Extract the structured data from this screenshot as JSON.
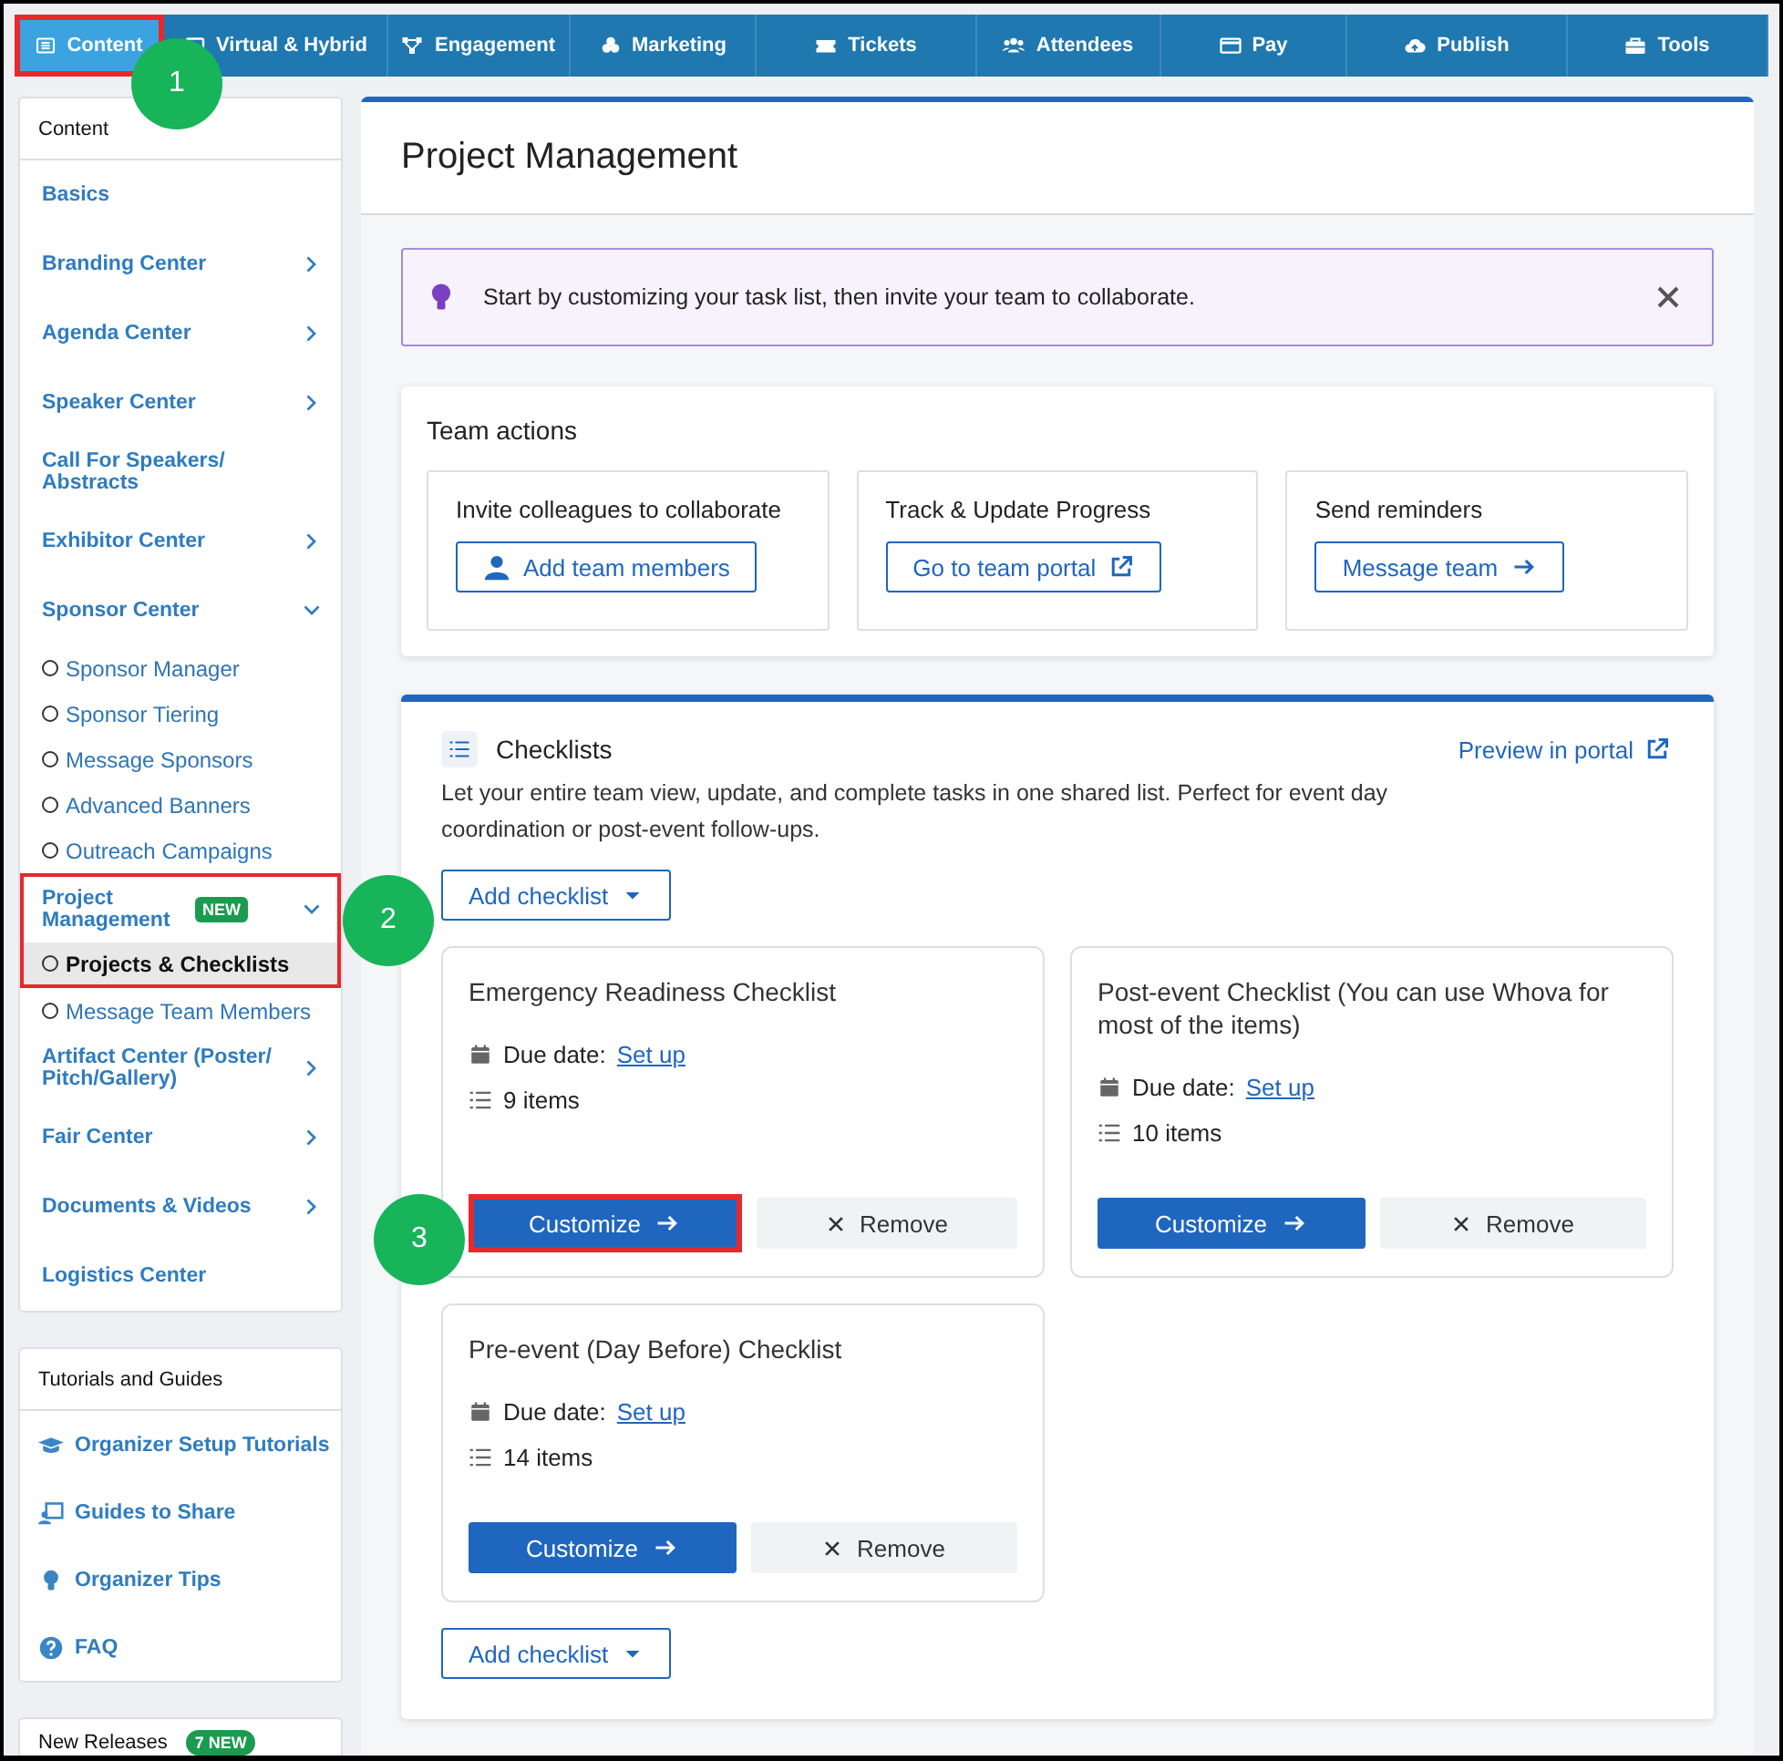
{
  "top_nav": [
    {
      "label": "Content",
      "selected": true,
      "highlighted": true
    },
    {
      "label": "Virtual & Hybrid",
      "selected": false,
      "highlighted": false
    },
    {
      "label": "Engagement",
      "selected": false,
      "highlighted": false
    },
    {
      "label": "Marketing",
      "selected": false,
      "highlighted": false
    },
    {
      "label": "Tickets",
      "selected": false,
      "highlighted": false
    },
    {
      "label": "Attendees",
      "selected": false,
      "highlighted": false
    },
    {
      "label": "Pay",
      "selected": false,
      "highlighted": false
    },
    {
      "label": "Publish",
      "selected": false,
      "highlighted": false
    },
    {
      "label": "Tools",
      "selected": false,
      "highlighted": false
    }
  ],
  "sidebar": {
    "title": "Content",
    "items": [
      {
        "label": "Basics",
        "kind": "link",
        "highlighted": false
      },
      {
        "label": "Branding Center",
        "kind": "menu",
        "expanded": false,
        "highlighted": false
      },
      {
        "label": "Agenda Center",
        "kind": "menu",
        "expanded": false,
        "highlighted": false
      },
      {
        "label": "Speaker Center",
        "kind": "menu",
        "expanded": false,
        "highlighted": false
      },
      {
        "label": "Call For Speakers/ Abstracts",
        "kind": "link",
        "highlighted": false
      },
      {
        "label": "Exhibitor Center",
        "kind": "menu",
        "expanded": false,
        "highlighted": false
      },
      {
        "label": "Sponsor Center",
        "kind": "menu",
        "expanded": true,
        "highlighted": false,
        "children": [
          {
            "label": "Sponsor Manager",
            "kind": "subitem",
            "selected": false,
            "highlighted": false
          },
          {
            "label": "Sponsor Tiering",
            "kind": "subitem",
            "selected": false,
            "highlighted": false
          },
          {
            "label": "Message Sponsors",
            "kind": "subitem",
            "selected": false,
            "highlighted": false
          },
          {
            "label": "Advanced Banners",
            "kind": "subitem",
            "selected": false,
            "highlighted": false
          },
          {
            "label": "Outreach Campaigns",
            "kind": "subitem",
            "selected": false,
            "highlighted": false
          }
        ]
      },
      {
        "label": "Project Management",
        "badge": "NEW",
        "kind": "menu",
        "expanded": true,
        "highlighted": true,
        "children": [
          {
            "label": "Projects & Checklists",
            "kind": "subitem",
            "selected": true,
            "highlighted": true
          },
          {
            "label": "Message Team Members",
            "kind": "subitem",
            "selected": false,
            "highlighted": false
          }
        ]
      },
      {
        "label": "Artifact Center (Poster/ Pitch/Gallery)",
        "kind": "menu",
        "expanded": false,
        "highlighted": false
      },
      {
        "label": "Fair Center",
        "kind": "menu",
        "expanded": false,
        "highlighted": false
      },
      {
        "label": "Documents & Videos",
        "kind": "menu",
        "expanded": false,
        "highlighted": false
      },
      {
        "label": "Logistics Center",
        "kind": "link",
        "highlighted": false
      }
    ]
  },
  "tutorials": {
    "title": "Tutorials and Guides",
    "items": [
      {
        "label": "Organizer Setup Tutorials"
      },
      {
        "label": "Guides to Share"
      },
      {
        "label": "Organizer Tips"
      },
      {
        "label": "FAQ"
      }
    ]
  },
  "new_releases": {
    "title": "New Releases",
    "badge": "7 NEW"
  },
  "page_title": "Project Management",
  "notice": {
    "text": "Start by customizing your task list, then invite your team to collaborate."
  },
  "team_actions": {
    "title": "Team actions",
    "cards": [
      {
        "title": "Invite colleagues to collaborate",
        "button": "Add team members"
      },
      {
        "title": "Track & Update Progress",
        "button": "Go to team portal"
      },
      {
        "title": "Send reminders",
        "button": "Message team"
      }
    ]
  },
  "checklists": {
    "title": "Checklists",
    "preview_link": "Preview in portal",
    "description": "Let your entire team view, update, and complete tasks in one shared list. Perfect for event day coordination or post-event follow-ups.",
    "add_button": "Add checklist",
    "items": [
      {
        "title": "Emergency Readiness Checklist",
        "due_label": "Due date:",
        "due_link": "Set up",
        "count": "9 items",
        "customize": "Customize",
        "remove": "Remove",
        "highlighted": true
      },
      {
        "title": "Post-event Checklist (You can use Whova for most of the items)",
        "due_label": "Due date:",
        "due_link": "Set up",
        "count": "10 items",
        "customize": "Customize",
        "remove": "Remove",
        "highlighted": false
      },
      {
        "title": "Pre-event (Day Before) Checklist",
        "due_label": "Due date:",
        "due_link": "Set up",
        "count": "14 items",
        "customize": "Customize",
        "remove": "Remove",
        "highlighted": false
      }
    ],
    "add_button_bottom": "Add checklist"
  },
  "callouts": [
    {
      "label": "1"
    },
    {
      "label": "2"
    },
    {
      "label": "3"
    }
  ]
}
